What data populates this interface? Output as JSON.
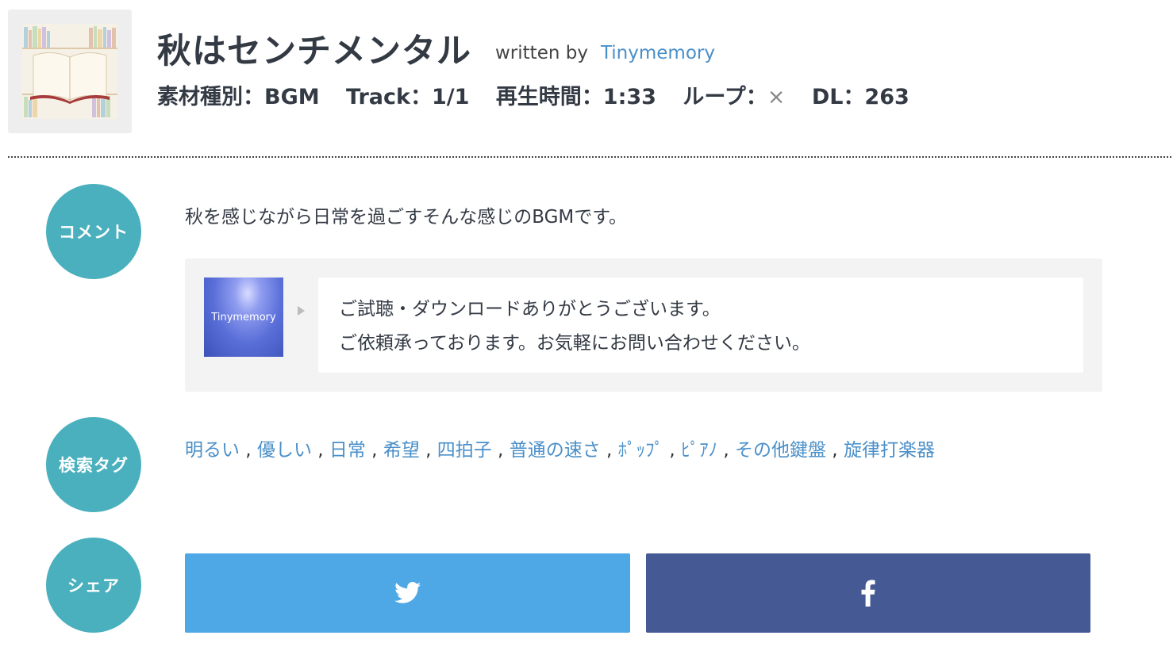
{
  "header": {
    "title": "秋はセンチメンタル",
    "written_by_label": "written by",
    "author": "Tinymemory"
  },
  "meta": {
    "type": "素材種別：BGM",
    "track": "Track：1/1",
    "duration": "再生時間：1:33",
    "loop_label": "ループ：",
    "loop_value": "×",
    "dl": "DL：263"
  },
  "comment": {
    "label": "コメント",
    "text": "秋を感じながら日常を過ごすそんな感じのBGMです。",
    "avatar_text": "Tinymemory",
    "message_line1": "ご試聴・ダウンロードありがとうございます。",
    "message_line2": "ご依頼承っております。お気軽にお問い合わせください。"
  },
  "tags": {
    "label": "検索タグ",
    "items": [
      "明るい",
      "優しい",
      "日常",
      "希望",
      "四拍子",
      "普通の速さ",
      "ﾎﾟｯﾌﾟ",
      "ﾋﾟｱﾉ",
      "その他鍵盤",
      "旋律打楽器"
    ],
    "separator": ","
  },
  "share": {
    "label": "シェア",
    "twitter_icon": "twitter-bird-icon",
    "facebook_icon": "facebook-f-icon"
  },
  "colors": {
    "accent": "#4ab0be",
    "link": "#4a8fc9",
    "twitter": "#4fa8e6",
    "facebook": "#455a95"
  }
}
